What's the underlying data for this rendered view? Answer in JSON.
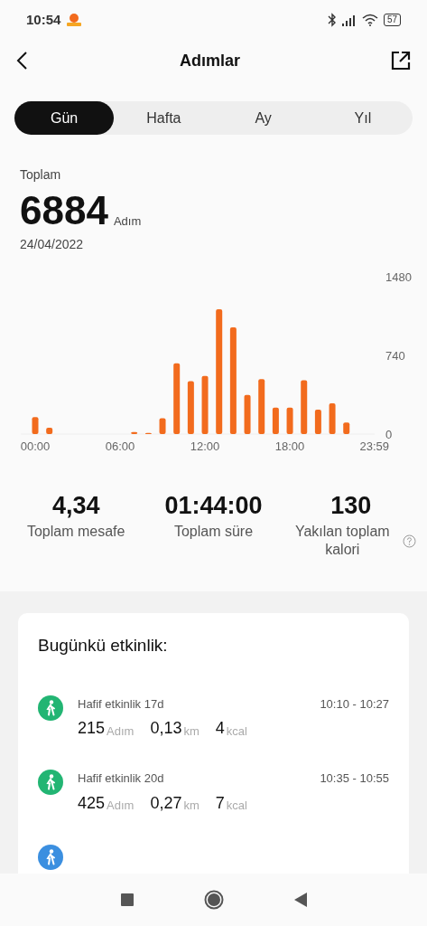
{
  "status_bar": {
    "time": "10:54",
    "battery": "57"
  },
  "header": {
    "title": "Adımlar"
  },
  "tabs": [
    {
      "label": "Gün",
      "selected": true
    },
    {
      "label": "Hafta",
      "selected": false
    },
    {
      "label": "Ay",
      "selected": false
    },
    {
      "label": "Yıl",
      "selected": false
    }
  ],
  "summary": {
    "label": "Toplam",
    "value": "6884",
    "unit": "Adım",
    "date": "24/04/2022"
  },
  "chart_data": {
    "type": "bar",
    "x": [
      0,
      1,
      2,
      3,
      4,
      5,
      6,
      7,
      8,
      9,
      10,
      11,
      12,
      13,
      14,
      15,
      16,
      17,
      18,
      19,
      20,
      21,
      22,
      23
    ],
    "series": [
      {
        "color": "#f26b1d",
        "values": [
          160,
          60,
          0,
          0,
          0,
          0,
          0,
          20,
          10,
          150,
          670,
          500,
          550,
          1180,
          1010,
          370,
          520,
          250,
          250,
          510,
          230,
          290,
          110,
          0
        ]
      }
    ],
    "xlim": [
      -1,
      24
    ],
    "ylim": [
      0,
      1480
    ],
    "yticks": [
      0,
      740,
      1480
    ],
    "xticks": [
      {
        "value": 0,
        "label": "00:00"
      },
      {
        "value": 6,
        "label": "06:00"
      },
      {
        "value": 12,
        "label": "12:00"
      },
      {
        "value": 18,
        "label": "18:00"
      },
      {
        "value": 23.98,
        "label": "23:59"
      }
    ]
  },
  "stats": [
    {
      "value": "4,34",
      "label": "Toplam mesafe",
      "help": false
    },
    {
      "value": "01:44:00",
      "label": "Toplam süre",
      "help": false
    },
    {
      "value": "130",
      "label": "Yakılan toplam kalori",
      "help": true
    }
  ],
  "activity": {
    "title": "Bugünkü etkinlik:",
    "items": [
      {
        "color": "#22b573",
        "name": "Hafif etkinlik 17d",
        "time": "10:10 - 10:27",
        "steps": "215",
        "steps_unit": "Adım",
        "distance": "0,13",
        "distance_unit": "km",
        "calories": "4",
        "calories_unit": "kcal"
      },
      {
        "color": "#22b573",
        "name": "Hafif etkinlik 20d",
        "time": "10:35 - 10:55",
        "steps": "425",
        "steps_unit": "Adım",
        "distance": "0,27",
        "distance_unit": "km",
        "calories": "7",
        "calories_unit": "kcal"
      },
      {
        "color": "#3b8fe0"
      }
    ]
  }
}
